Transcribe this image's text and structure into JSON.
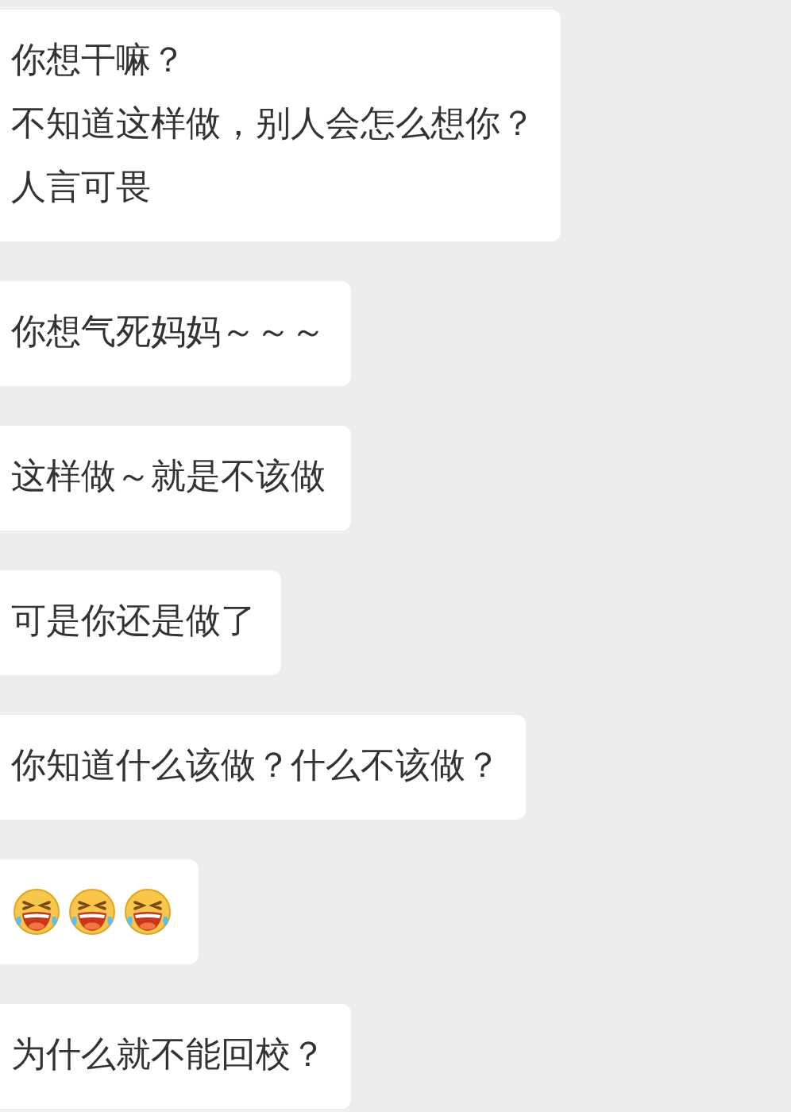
{
  "messages": [
    {
      "kind": "text",
      "lines": [
        "你想干嘛？",
        "不知道这样做，别人会怎么想你？",
        "人言可畏"
      ]
    },
    {
      "kind": "text",
      "lines": [
        "你想气死妈妈～～～"
      ]
    },
    {
      "kind": "text",
      "lines": [
        "这样做～就是不该做"
      ]
    },
    {
      "kind": "text",
      "lines": [
        "可是你还是做了"
      ]
    },
    {
      "kind": "text",
      "lines": [
        "你知道什么该做？什么不该做？"
      ]
    },
    {
      "kind": "emoji",
      "items": [
        {
          "kind": "laugh"
        },
        {
          "kind": "laugh"
        },
        {
          "kind": "laugh"
        }
      ]
    },
    {
      "kind": "text",
      "lines": [
        "为什么就不能回校？"
      ]
    }
  ]
}
